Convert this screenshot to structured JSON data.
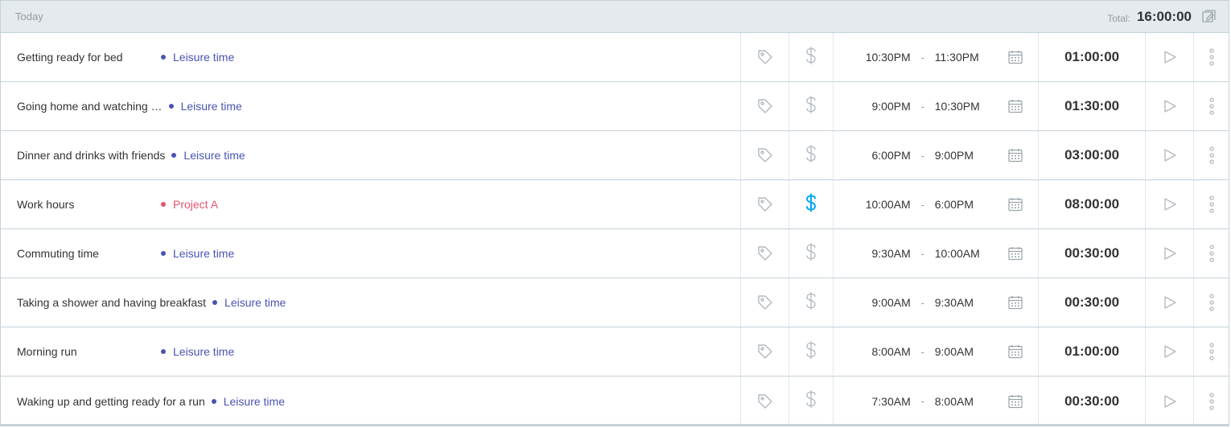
{
  "header": {
    "day": "Today",
    "total_label": "Total:",
    "total_value": "16:00:00",
    "bulk_icon": "bulk-edit-icon"
  },
  "colors": {
    "leisure": "#4a54b1",
    "project_a": "#e2546f",
    "billable_active": "#03a9f4",
    "icon_muted": "#b0b8bf"
  },
  "entries": [
    {
      "description": "Getting ready for bed",
      "project": "Leisure time",
      "project_color": "#4a54b1",
      "billable": false,
      "start": "10:30PM",
      "end": "11:30PM",
      "duration": "01:00:00"
    },
    {
      "description": "Going home and watching …",
      "project": "Leisure time",
      "project_color": "#4a54b1",
      "billable": false,
      "start": "9:00PM",
      "end": "10:30PM",
      "duration": "01:30:00"
    },
    {
      "description": "Dinner and drinks with friends",
      "project": "Leisure time",
      "project_color": "#4a54b1",
      "billable": false,
      "start": "6:00PM",
      "end": "9:00PM",
      "duration": "03:00:00"
    },
    {
      "description": "Work hours",
      "project": "Project A",
      "project_color": "#e2546f",
      "billable": true,
      "start": "10:00AM",
      "end": "6:00PM",
      "duration": "08:00:00"
    },
    {
      "description": "Commuting time",
      "project": "Leisure time",
      "project_color": "#4a54b1",
      "billable": false,
      "start": "9:30AM",
      "end": "10:00AM",
      "duration": "00:30:00"
    },
    {
      "description": "Taking a shower and having breakfast",
      "project": "Leisure time",
      "project_color": "#4a54b1",
      "billable": false,
      "start": "9:00AM",
      "end": "9:30AM",
      "duration": "00:30:00"
    },
    {
      "description": "Morning run",
      "project": "Leisure time",
      "project_color": "#4a54b1",
      "billable": false,
      "start": "8:00AM",
      "end": "9:00AM",
      "duration": "01:00:00"
    },
    {
      "description": "Waking up and getting ready for a run",
      "project": "Leisure time",
      "project_color": "#4a54b1",
      "billable": false,
      "start": "7:30AM",
      "end": "8:00AM",
      "duration": "00:30:00"
    }
  ]
}
